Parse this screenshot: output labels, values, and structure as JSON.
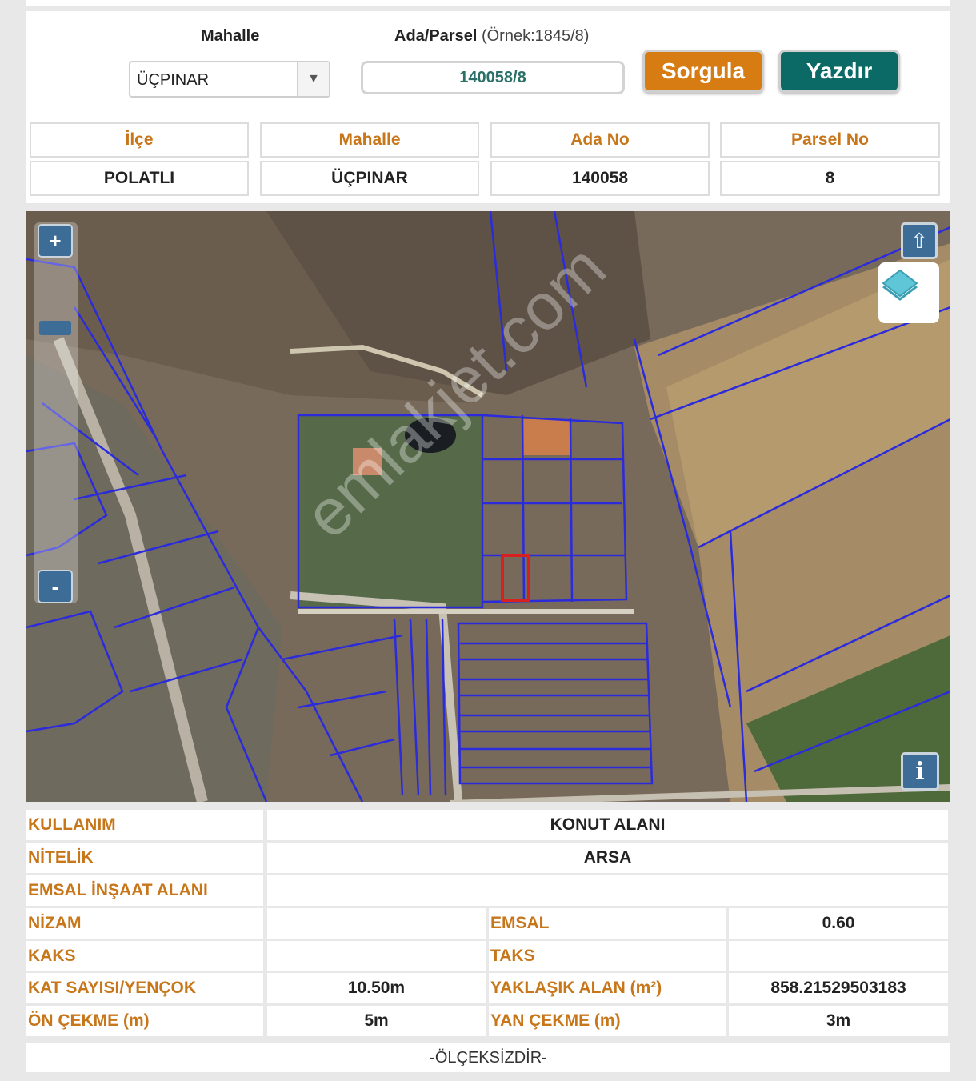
{
  "query": {
    "mahalle_label": "Mahalle",
    "ada_label_bold": "Ada/Parsel",
    "ada_label_hint": " (Örnek:1845/8)",
    "mahalle_value": "ÜÇPINAR",
    "ada_parsel_value": "140058/8",
    "sorgula_label": "Sorgula",
    "yazdir_label": "Yazdır",
    "colors": {
      "sorgula": "#d77b13",
      "yazdir": "#0c6a66",
      "heading": "#c8761a"
    }
  },
  "summary": {
    "headers": [
      "İlçe",
      "Mahalle",
      "Ada No",
      "Parsel No"
    ],
    "values": [
      "POLATLI",
      "ÜÇPINAR",
      "140058",
      "8"
    ]
  },
  "map": {
    "zoom_in": "+",
    "zoom_out": "-",
    "north_icon": "up-arrow-icon",
    "layers_icon": "layers-icon",
    "info_label": "i",
    "watermark": "emlakjet.com",
    "selected_parcel_color": "#d8201e",
    "parcel_line_color": "#2b2bdc"
  },
  "details": {
    "kullanim_k": "KULLANIM",
    "kullanim_v": "KONUT ALANI",
    "nitelik_k": "NİTELİK",
    "nitelik_v": "ARSA",
    "emsal_insaat_k": "EMSAL İNŞAAT ALANI",
    "emsal_insaat_v": "",
    "nizam_k": "NİZAM",
    "nizam_v": "",
    "emsal_k": "EMSAL",
    "emsal_v": "0.60",
    "kaks_k": "KAKS",
    "kaks_v": "",
    "taks_k": "TAKS",
    "taks_v": "",
    "kat_k": "KAT SAYISI/YENÇOK",
    "kat_v": "10.50m",
    "alan_k": "YAKLAŞIK ALAN (m²)",
    "alan_v": "858.21529503183",
    "on_k": "ÖN ÇEKME (m)",
    "on_v": "5m",
    "yan_k": "YAN ÇEKME (m)",
    "yan_v": "3m"
  },
  "footer": {
    "scale_note": "-ÖLÇEKSİZDİR-"
  }
}
